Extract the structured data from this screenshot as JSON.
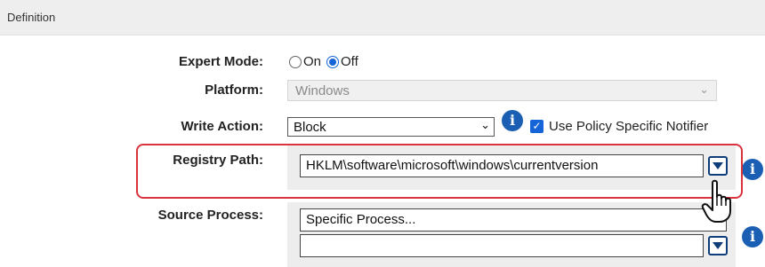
{
  "section": {
    "title": "Definition"
  },
  "form": {
    "expert_mode": {
      "label": "Expert Mode:",
      "options": [
        {
          "label": "On",
          "selected": false
        },
        {
          "label": "Off",
          "selected": true
        }
      ]
    },
    "platform": {
      "label": "Platform:",
      "value": "Windows",
      "disabled": true
    },
    "write_action": {
      "label": "Write Action:",
      "value": "Block",
      "checkbox_label": "Use Policy Specific Notifier",
      "checkbox_checked": true
    },
    "registry_path": {
      "label": "Registry Path:",
      "value": "HKLM\\software\\microsoft\\windows\\currentversion"
    },
    "source_process": {
      "label": "Source Process:",
      "value": "Specific Process...",
      "second_value": ""
    }
  },
  "icons": {
    "info": "info-icon",
    "dropdown": "dropdown-arrow-icon",
    "cursor": "hand-pointer-icon"
  },
  "colors": {
    "accent": "#1565d8",
    "info": "#1a5fb4",
    "highlight": "#d9343e",
    "header_bg": "#eeeeee",
    "panel_bg": "#ededed"
  }
}
